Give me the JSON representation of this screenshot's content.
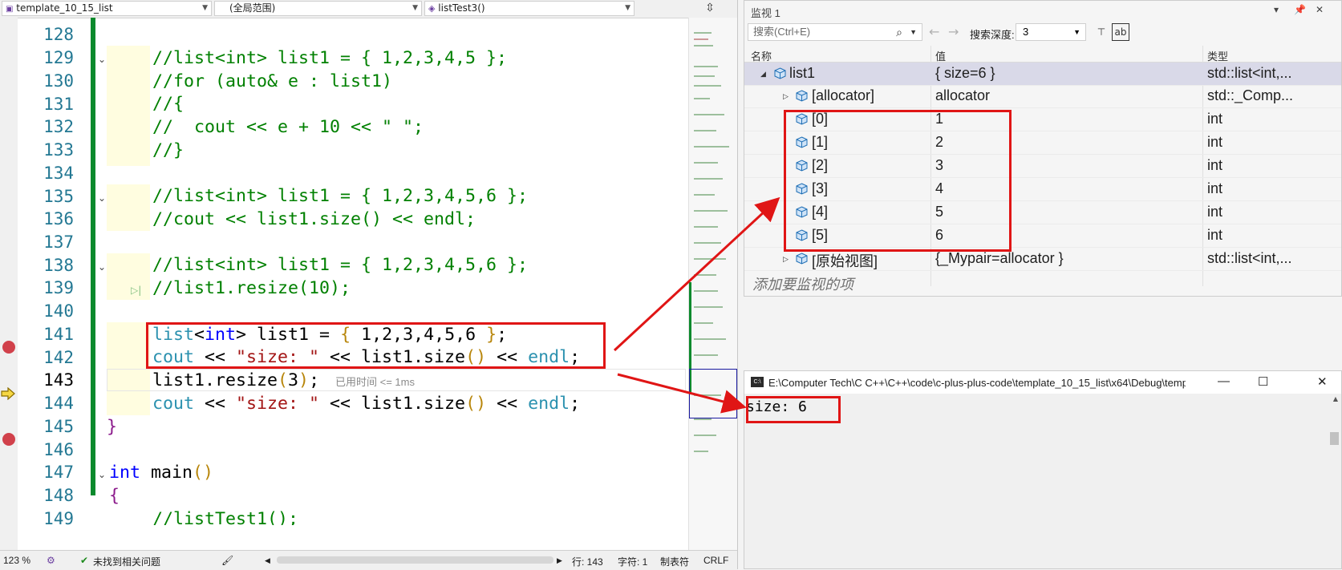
{
  "editor": {
    "nav": {
      "project": "template_10_15_list",
      "scope": "(全局范围)",
      "function": "listTest3()"
    },
    "lines": [
      {
        "num": "128",
        "text": ""
      },
      {
        "num": "129",
        "text": "//list<int> list1 = { 1,2,3,4,5 };"
      },
      {
        "num": "130",
        "text": "//for (auto& e : list1)"
      },
      {
        "num": "131",
        "text": "//{"
      },
      {
        "num": "132",
        "text": "//  cout << e + 10 << \" \";"
      },
      {
        "num": "133",
        "text": "//}"
      },
      {
        "num": "134",
        "text": ""
      },
      {
        "num": "135",
        "text": "//list<int> list1 = { 1,2,3,4,5,6 };"
      },
      {
        "num": "136",
        "text": "//cout << list1.size() << endl;"
      },
      {
        "num": "137",
        "text": ""
      },
      {
        "num": "138",
        "text": "//list<int> list1 = { 1,2,3,4,5,6 };"
      },
      {
        "num": "139",
        "text": "//list1.resize(10);"
      },
      {
        "num": "140",
        "text": ""
      },
      {
        "num": "141",
        "text": "list<int> list1 = { 1,2,3,4,5,6 };"
      },
      {
        "num": "142",
        "text": "cout << \"size: \" << list1.size() << endl;"
      },
      {
        "num": "143",
        "text": "list1.resize(3);"
      },
      {
        "num": "144",
        "text": "cout << \"size: \" << list1.size() << endl;"
      },
      {
        "num": "145",
        "text": "}"
      },
      {
        "num": "146",
        "text": ""
      },
      {
        "num": "147",
        "text": "int main()"
      },
      {
        "num": "148",
        "text": "{"
      },
      {
        "num": "149",
        "text": "//listTest1();"
      }
    ],
    "elapsed_hint": "已用时间 <= 1ms"
  },
  "status": {
    "zoom": "123 %",
    "issues": "未找到相关问题",
    "line": "行: 143",
    "char": "字符: 1",
    "indent": "制表符",
    "eol": "CRLF"
  },
  "watch": {
    "title": "监视 1",
    "search_placeholder": "搜索(Ctrl+E)",
    "depth_label": "搜索深度:",
    "depth_value": "3",
    "columns": {
      "name": "名称",
      "value": "值",
      "type": "类型"
    },
    "rows": [
      {
        "name": "list1",
        "value": "{ size=6 }",
        "type": "std::list<int,..."
      },
      {
        "name": "[allocator]",
        "value": "allocator",
        "type": "std::_Comp..."
      },
      {
        "name": "[0]",
        "value": "1",
        "type": "int"
      },
      {
        "name": "[1]",
        "value": "2",
        "type": "int"
      },
      {
        "name": "[2]",
        "value": "3",
        "type": "int"
      },
      {
        "name": "[3]",
        "value": "4",
        "type": "int"
      },
      {
        "name": "[4]",
        "value": "5",
        "type": "int"
      },
      {
        "name": "[5]",
        "value": "6",
        "type": "int"
      },
      {
        "name": "[原始视图]",
        "value": "{_Mypair=allocator }",
        "type": "std::list<int,..."
      }
    ],
    "add_item": "添加要监视的项"
  },
  "console": {
    "title": "E:\\Computer Tech\\C C++\\C++\\code\\c-plus-plus-code\\template_10_15_list\\x64\\Debug\\template_...",
    "icon_text": "C:\\",
    "output": "size: 6"
  },
  "colors": {
    "comment": "#008000",
    "keyword": "#0000ff",
    "type": "#2b91af",
    "string": "#a31515",
    "breakpoint": "#d1414b",
    "annotation": "#e01515",
    "change_bar": "#0b8a2d"
  }
}
